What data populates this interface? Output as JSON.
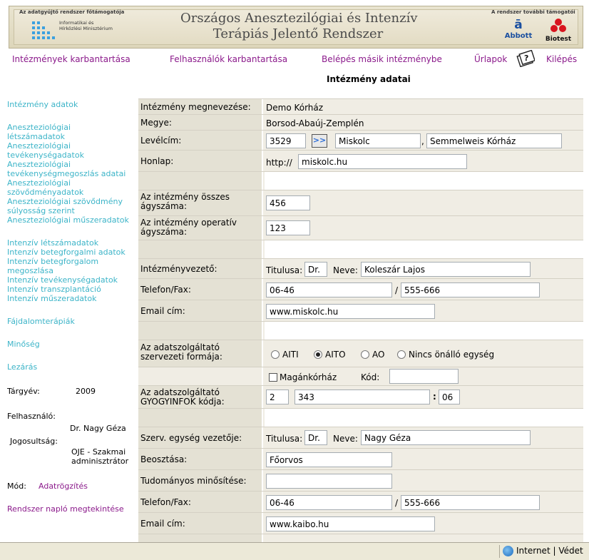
{
  "banner": {
    "sponsor_left": "Az adatgyűjtő rendszer főtámogatója",
    "ministry": "Informatikai és Hírközlési Minisztérium",
    "title_line1": "Országos Anesztezilógiai és Intenzív",
    "title_line2": "Terápiás Jelentő Rendszer",
    "sponsor_right": "A rendszer további támogatói",
    "abbott": "Abbott",
    "biotest": "Biotest"
  },
  "topnav": {
    "institutions": "Intézmények karbantartása",
    "users": "Felhasználók karbantartása",
    "other_institution": "Belépés másik intézménybe",
    "forms": "Űrlapok",
    "logout": "Kilépés"
  },
  "page_title": "Intézmény adatai",
  "sidebar": {
    "institution_data": "Intézmény adatok",
    "anest_links": [
      "Aneszteziológiai",
      "létszámadatok",
      "Aneszteziológiai",
      "tevékenységadatok",
      "Aneszteziológiai",
      "tevékenységmegoszlás adatai",
      "Aneszteziológiai",
      "szövődményadatok",
      "Aneszteziológiai szövődmény",
      "súlyosság szerint",
      "Aneszteziológiai műszeradatok"
    ],
    "intensive_links": [
      "Intenzív létszámadatok",
      "Intenzív betegforgalmi adatok",
      "Intenzív betegforgalom",
      "megoszlása",
      "Intenzív tevékenységadatok",
      "Intenzív transzplantáció",
      "Intenzív műszeradatok"
    ],
    "pain_therapy": "Fájdalomterápiák",
    "quality": "Minőség",
    "closing": "Lezárás",
    "year_label": "Tárgyév:",
    "year_value": "2009",
    "user_label": "Felhasználó:",
    "user_value": "Dr. Nagy Géza",
    "permission_label": "Jogosultság:",
    "permission_value_1": "OJE - Szakmai",
    "permission_value_2": "adminisztrátor",
    "mode_label": "Mód:",
    "mode_value": "Adatrögzítés",
    "log_link": "Rendszer napló megtekintése"
  },
  "form": {
    "name_label": "Intézmény megnevezése:",
    "name_value": "Demo Kórház",
    "county_label": "Megye:",
    "county_value": "Borsod-Abaúj-Zemplén",
    "address_label": "Levélcím:",
    "zip": "3529",
    "lookup_button": ">>",
    "city": "Miskolc",
    "street": "Semmelweis Kórház",
    "homepage_label": "Honlap:",
    "http_prefix": "http://",
    "homepage": "miskolc.hu",
    "beds_label": "Az intézmény összes ágyszáma:",
    "beds_value": "456",
    "op_beds_label": "Az intézmény operatív ágyszáma:",
    "op_beds_value": "123",
    "head_label": "Intézményvezető:",
    "title_label": "Titulusa:",
    "head_title": "Dr.",
    "name_field_label": "Neve:",
    "head_name": "Koleszár Lajos",
    "phone_label": "Telefon/Fax:",
    "phone": "06-46",
    "fax": "555-666",
    "email_label": "Email cím:",
    "email": "www.miskolc.hu",
    "org_form_label": "Az adatszolgáltató szervezeti formája:",
    "org_options": [
      "AITI",
      "AITO",
      "AO",
      "Nincs önálló egység"
    ],
    "org_selected": "AITO",
    "private_label": "Magánkórház",
    "code_label": "Kód:",
    "code_value": "",
    "gyogyinfok_label": "Az adatszolgáltató GYOGYINFOK kódja:",
    "gyogy_1": "2",
    "gyogy_2": "343",
    "gyogy_3": "06",
    "unit_head_label": "Szerv. egység vezetője:",
    "unit_head_title": "Dr.",
    "unit_head_name": "Nagy Géza",
    "position_label": "Beosztása:",
    "position_value": "Főorvos",
    "degree_label": "Tudományos minősítése:",
    "degree_value": "",
    "phone2": "06-46",
    "fax2": "555-666",
    "email2": "www.kaibo.hu"
  },
  "statusbar": {
    "zone": "Internet | Védet"
  },
  "colors": {
    "link_purple": "#8b1a8b",
    "link_teal": "#3cb4c8",
    "label_bg": "#e4e1d4",
    "field_bg": "#f0ede4"
  }
}
